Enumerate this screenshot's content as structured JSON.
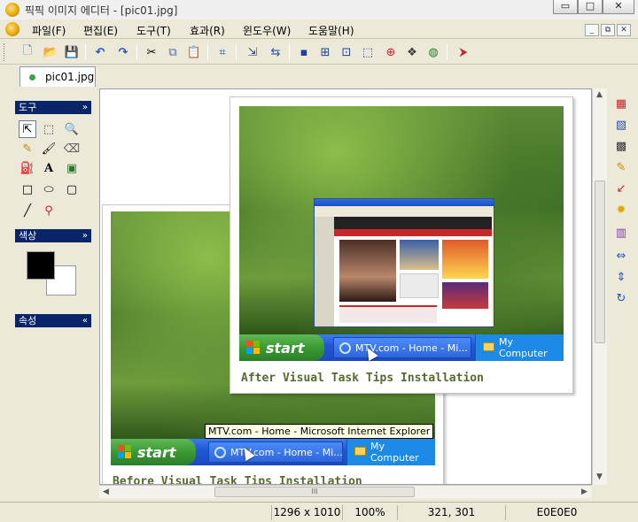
{
  "window": {
    "title": "픽픽 이미지 에디터 - [pic01.jpg]",
    "min_glyph": "▭",
    "max_glyph": "□",
    "close_glyph": "✕"
  },
  "menu": {
    "items": [
      "파일(F)",
      "편집(E)",
      "도구(T)",
      "효과(R)",
      "윈도우(W)",
      "도움말(H)"
    ],
    "mdi_min": "_",
    "mdi_restore": "⧉",
    "mdi_close": "✕"
  },
  "toolbar": {
    "icons": [
      "new-file-icon",
      "open-folder-icon",
      "save-icon",
      "undo-icon",
      "redo-icon",
      "cut-icon",
      "copy-icon",
      "paste-icon",
      "crop-icon",
      "resize-icon",
      "rotate-icon",
      "rect-icon",
      "add-icon",
      "zoom-icon",
      "select-icon",
      "grid-icon",
      "effect-icon",
      "globe-icon",
      "share-icon"
    ],
    "glyphs": [
      "🗋",
      "📂",
      "💾",
      "↶",
      "↷",
      "✂",
      "⧉",
      "📋",
      "⌗",
      "⇲",
      "⇆",
      "▪",
      "⊞",
      "⊡",
      "⬚",
      "⊕",
      "❖",
      "◍",
      "⮞"
    ]
  },
  "tabs": [
    {
      "label": "pic01.jpg"
    }
  ],
  "panels": {
    "tools": {
      "title": "도구",
      "chevron": "»",
      "items": [
        {
          "name": "pointer-tool-icon",
          "glyph": "⇱"
        },
        {
          "name": "marquee-tool-icon",
          "glyph": "⬚"
        },
        {
          "name": "magnifier-tool-icon",
          "glyph": "🔍"
        },
        {
          "name": "pencil-tool-icon",
          "glyph": "✎"
        },
        {
          "name": "brush-tool-icon",
          "glyph": "🖌"
        },
        {
          "name": "eraser-tool-icon",
          "glyph": "⌫"
        },
        {
          "name": "fill-tool-icon",
          "glyph": "⛽"
        },
        {
          "name": "text-tool-icon",
          "glyph": "A"
        },
        {
          "name": "image-tool-icon",
          "glyph": "▣"
        },
        {
          "name": "rectangle-tool-icon",
          "glyph": "□"
        },
        {
          "name": "ellipse-tool-icon",
          "glyph": "⬭"
        },
        {
          "name": "rounded-rect-tool-icon",
          "glyph": "▢"
        },
        {
          "name": "line-tool-icon",
          "glyph": "╱"
        },
        {
          "name": "eyedropper-tool-icon",
          "glyph": "⚲"
        }
      ]
    },
    "colors": {
      "title": "색상",
      "chevron": "»",
      "foreground": "#000000",
      "background": "#ffffff"
    },
    "properties": {
      "title": "속성",
      "chevron": "«"
    }
  },
  "canvas": {
    "back_photo": {
      "taskbar_start": "start",
      "taskbar_window": "MTV.com - Home - Mi...",
      "taskbar_tray": "My Computer",
      "caption": "Before Visual Task Tips Installation",
      "tooltip": "MTV.com - Home - Microsoft Internet Explorer"
    },
    "front_photo": {
      "taskbar_start": "start",
      "taskbar_window": "MTV.com - Home - Mi...",
      "taskbar_tray": "My Computer",
      "caption": "After Visual Task Tips Installation"
    },
    "hscroll_thumb_glyph": "III"
  },
  "right_toolbar": {
    "icons": [
      "filter-icon",
      "image-icon",
      "mosaic-icon",
      "pen-icon",
      "arrow-icon",
      "sparkle-icon",
      "gradient-icon",
      "flip-horizontal-icon",
      "flip-vertical-icon",
      "rotate-icon"
    ],
    "glyphs": [
      "▦",
      "▧",
      "▩",
      "✎",
      "↙",
      "✹",
      "▥",
      "⇔",
      "⇕",
      "↻"
    ]
  },
  "status": {
    "dimensions": "1296 x 1010",
    "zoom": "100%",
    "coords": "321, 301",
    "color": "E0E0E0"
  }
}
